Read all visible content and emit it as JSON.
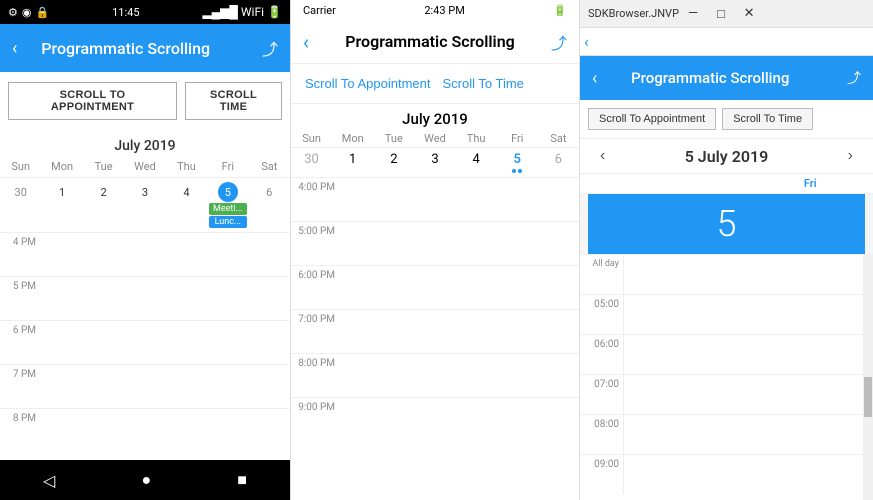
{
  "panel1": {
    "status_bar": {
      "time": "11:45",
      "battery": "🔋"
    },
    "header": {
      "title": "Programmatic Scrolling",
      "back_icon": "‹",
      "ext_icon": "⤴"
    },
    "buttons": {
      "scroll_to_appointment": "SCROLL TO APPOINTMENT",
      "scroll_to_time": "SCROLL TIME"
    },
    "calendar": {
      "month_title": "July 2019",
      "week_days": [
        "Sun",
        "Mon",
        "Tue",
        "Wed",
        "Thu",
        "Fri",
        "Sat"
      ],
      "weeks": [
        [
          {
            "num": "30",
            "prev": true
          },
          {
            "num": "1"
          },
          {
            "num": "2"
          },
          {
            "num": "3"
          },
          {
            "num": "4"
          },
          {
            "num": "5",
            "today": true,
            "events": [
              "Meeti...",
              "Lunc..."
            ]
          },
          {
            "num": "6"
          }
        ]
      ]
    },
    "times": [
      "4 PM",
      "5 PM",
      "6 PM",
      "7 PM",
      "8 PM"
    ],
    "nav_bar": {
      "back": "◁",
      "home": "●",
      "recent": "■"
    }
  },
  "panel2": {
    "status_bar": {
      "carrier": "Carrier",
      "wifi": "▾",
      "time": "2:43 PM",
      "battery": "🔋"
    },
    "header": {
      "title": "Programmatic Scrolling",
      "back_icon": "‹",
      "ext_icon": "⤴"
    },
    "buttons": {
      "scroll_to_appointment": "Scroll To Appointment",
      "scroll_to_time": "Scroll To Time"
    },
    "calendar": {
      "month_title": "July 2019",
      "week_days": [
        "Sun",
        "Mon",
        "Tue",
        "Wed",
        "Thu",
        "Fri",
        "Sat"
      ],
      "week_dates": [
        "30",
        "1",
        "2",
        "3",
        "4",
        "5",
        "6"
      ],
      "today_index": 5
    },
    "times": [
      "4:00 PM",
      "5:00 PM",
      "6:00 PM",
      "7:00 PM",
      "8:00 PM",
      "9:00 PM"
    ]
  },
  "panel3": {
    "title_bar": {
      "sdk_text": "SDKBrowser.JNVP",
      "min": "—",
      "max": "□",
      "close": "✕"
    },
    "address_bar": {
      "back_icon": "‹"
    },
    "header": {
      "title": "Programmatic Scrolling",
      "back_icon": "‹",
      "ext_icon": "⤴"
    },
    "buttons": {
      "scroll_to_appointment": "Scroll To Appointment",
      "scroll_to_time": "Scroll To Time"
    },
    "calendar": {
      "month_title": "5 July 2019",
      "prev_icon": "‹",
      "next_icon": "›",
      "week_days": [
        "",
        "",
        "",
        "",
        "",
        "Fri",
        ""
      ],
      "selected_day_label": "Fri",
      "selected_day_num": "5"
    },
    "times": [
      "All day",
      "05:00",
      "06:00",
      "07:00",
      "08:00",
      "09:00"
    ]
  }
}
